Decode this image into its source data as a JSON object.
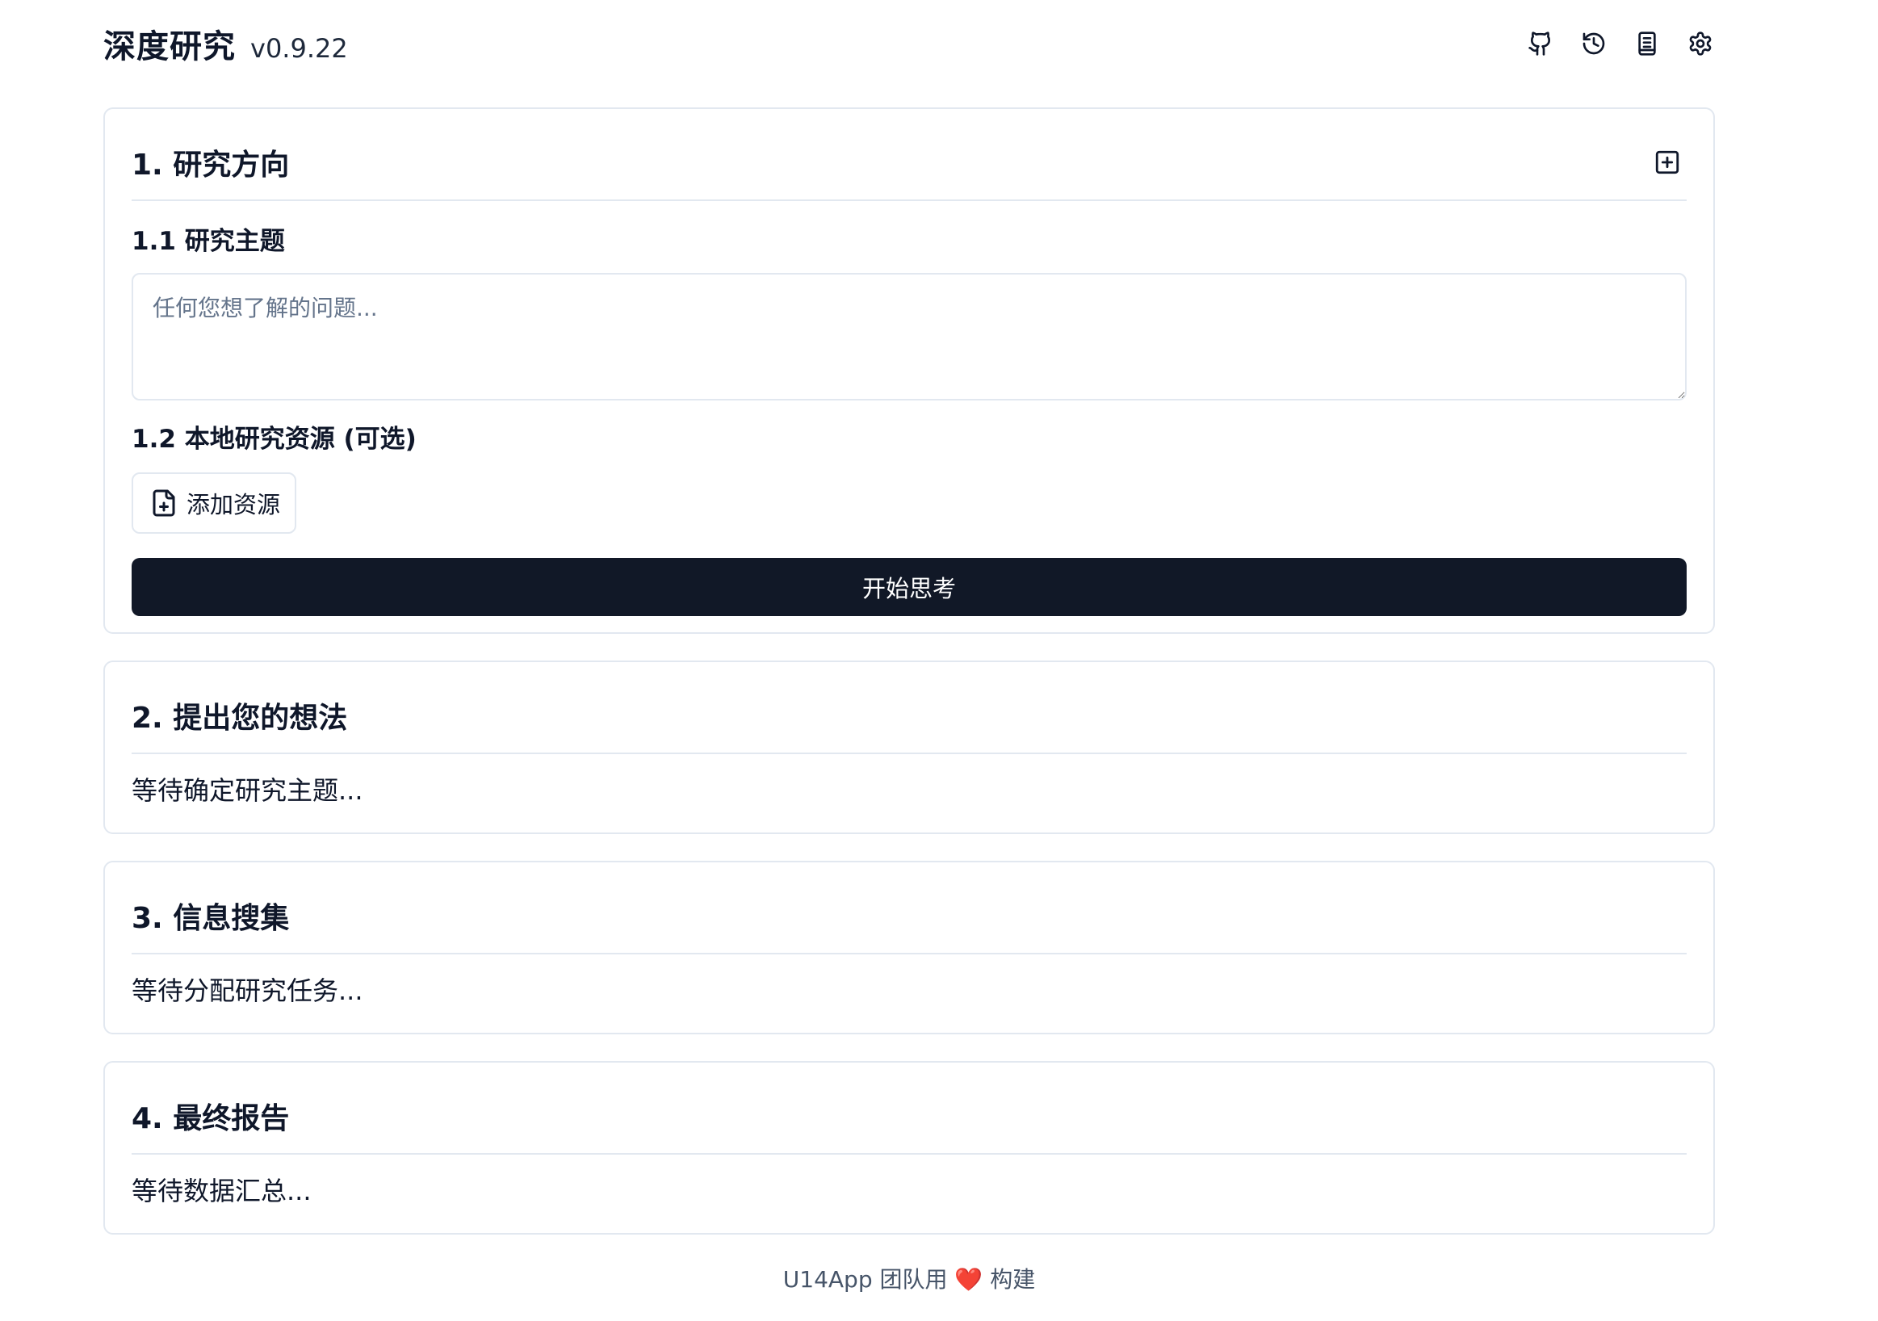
{
  "app": {
    "title": "深度研究",
    "version": "v0.9.22",
    "toolbar_icons": [
      "github-icon",
      "history-icon",
      "book-icon",
      "settings-icon"
    ]
  },
  "section1": {
    "title": "1. 研究方向",
    "add_icon": "plus-square-icon",
    "topic_label": "1.1 研究主题",
    "topic_placeholder": "任何您想了解的问题...",
    "topic_value": "",
    "resources_label": "1.2 本地研究资源 (可选)",
    "add_resource_label": "添加资源",
    "add_resource_icon": "file-plus-icon",
    "start_label": "开始思考"
  },
  "section2": {
    "title": "2. 提出您的想法",
    "status": "等待确定研究主题..."
  },
  "section3": {
    "title": "3. 信息搜集",
    "status": "等待分配研究任务..."
  },
  "section4": {
    "title": "4. 最终报告",
    "status": "等待数据汇总..."
  },
  "footer": {
    "prefix": "U14App 团队用",
    "heart": "❤️",
    "suffix": "构建"
  },
  "colors": {
    "primary": "#111827",
    "border": "#e2e8f0",
    "muted": "#64748b",
    "heart": "#dc2626"
  }
}
